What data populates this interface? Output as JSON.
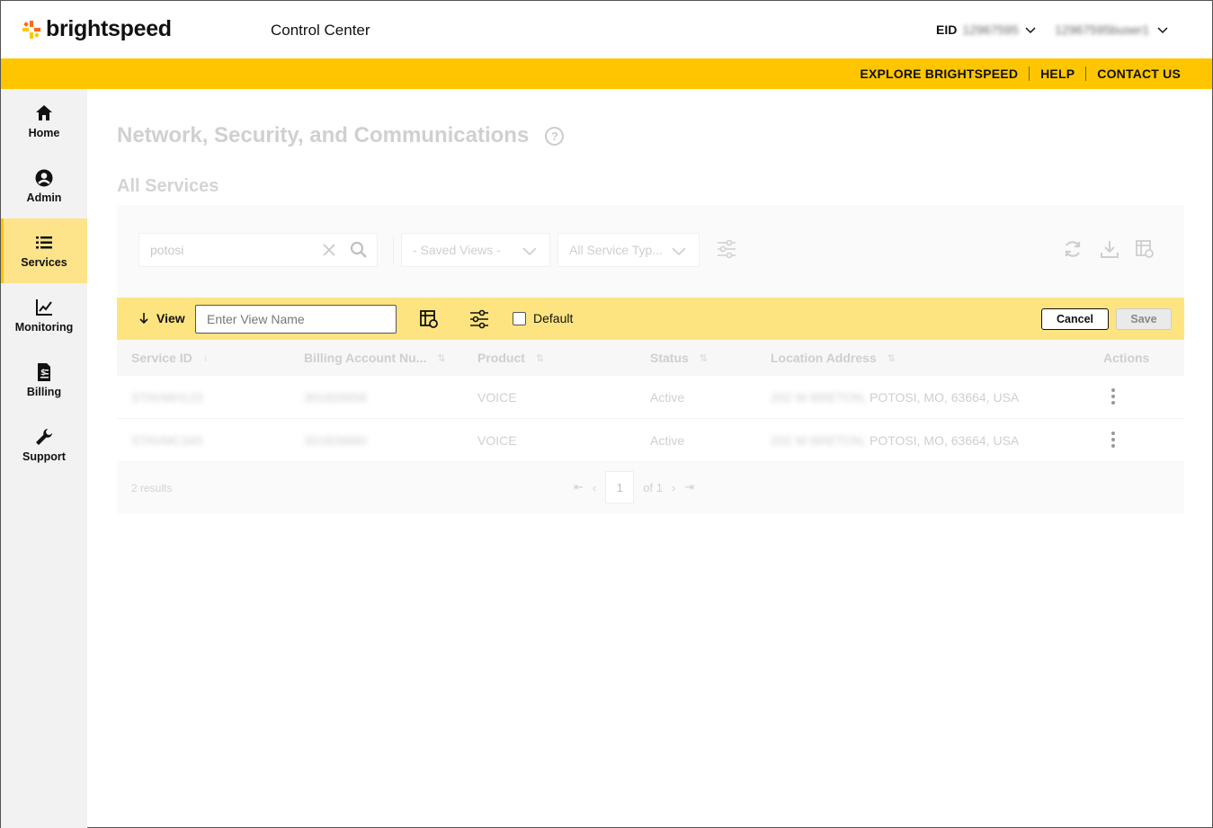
{
  "header": {
    "logo_text": "brightspeed",
    "app_title": "Control Center",
    "eid_label": "EID",
    "eid_value": "12967595",
    "user_name": "12967595buser1"
  },
  "topnav": {
    "items": [
      {
        "label": "EXPLORE BRIGHTSPEED"
      },
      {
        "label": "HELP"
      },
      {
        "label": "CONTACT US"
      }
    ]
  },
  "sidebar": {
    "items": [
      {
        "label": "Home",
        "icon": "home-icon"
      },
      {
        "label": "Admin",
        "icon": "user-circle-icon"
      },
      {
        "label": "Services",
        "icon": "list-icon",
        "active": true
      },
      {
        "label": "Monitoring",
        "icon": "chart-line-icon"
      },
      {
        "label": "Billing",
        "icon": "invoice-icon"
      },
      {
        "label": "Support",
        "icon": "wrench-icon"
      }
    ]
  },
  "page": {
    "title": "Network, Security, and Communications",
    "section_title": "All Services"
  },
  "toolbar": {
    "search_value": "potosi",
    "saved_views_label": "- Saved Views -",
    "service_type_label": "All Service Typ..."
  },
  "viewbar": {
    "view_label": "View",
    "view_name_placeholder": "Enter View Name",
    "default_label": "Default",
    "cancel_label": "Cancel",
    "save_label": "Save"
  },
  "table": {
    "columns": [
      "Service ID",
      "Billing Account Nu...",
      "Product",
      "Status",
      "Location Address",
      "Actions"
    ],
    "rows": [
      {
        "service_id": "STAVMH123",
        "billing": "301826656",
        "product": "VOICE",
        "status": "Active",
        "address_blur": "202 W BRETON,",
        "address": "POTOSI, MO, 63664, USA"
      },
      {
        "service_id": "STAVMC345",
        "billing": "301826660",
        "product": "VOICE",
        "status": "Active",
        "address_blur": "202 W BRETON,",
        "address": "POTOSI, MO, 63664, USA"
      }
    ]
  },
  "footer": {
    "results": "2 results",
    "page": "1",
    "of_label": "of 1"
  },
  "colors": {
    "brand_yellow": "#ffc600",
    "viewbar_yellow": "#fee481",
    "active_nav": "#fde38a"
  }
}
